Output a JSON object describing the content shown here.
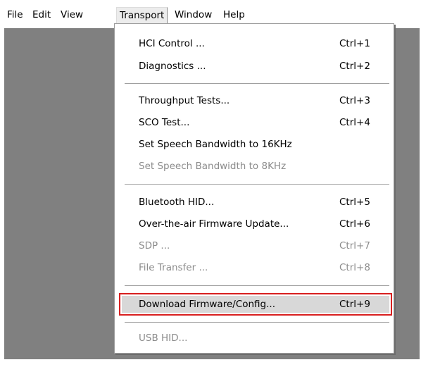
{
  "menubar": {
    "items": [
      {
        "label": "File"
      },
      {
        "label": "Edit"
      },
      {
        "label": "View"
      },
      {
        "label": "Transport"
      },
      {
        "label": "Window"
      },
      {
        "label": "Help"
      }
    ],
    "active": "Transport"
  },
  "transport_menu": {
    "items": [
      {
        "label": "HCI Control ...",
        "shortcut": "Ctrl+1",
        "enabled": true
      },
      {
        "label": "Diagnostics ...",
        "shortcut": "Ctrl+2",
        "enabled": true
      },
      {
        "label": "Throughput Tests...",
        "shortcut": "Ctrl+3",
        "enabled": true
      },
      {
        "label": "SCO Test...",
        "shortcut": "Ctrl+4",
        "enabled": true
      },
      {
        "label": "Set Speech Bandwidth to 16KHz",
        "shortcut": "",
        "enabled": true
      },
      {
        "label": "Set Speech Bandwidth to 8KHz",
        "shortcut": "",
        "enabled": false
      },
      {
        "label": "Bluetooth HID...",
        "shortcut": "Ctrl+5",
        "enabled": true
      },
      {
        "label": "Over-the-air Firmware Update...",
        "shortcut": "Ctrl+6",
        "enabled": true
      },
      {
        "label": "SDP ...",
        "shortcut": "Ctrl+7",
        "enabled": false
      },
      {
        "label": "File Transfer ...",
        "shortcut": "Ctrl+8",
        "enabled": false
      },
      {
        "label": "Download Firmware/Config...",
        "shortcut": "Ctrl+9",
        "enabled": true,
        "highlighted": true
      },
      {
        "label": "USB HID...",
        "shortcut": "",
        "enabled": false
      }
    ]
  },
  "colors": {
    "workspace": "#808080",
    "highlight_outline": "#d81f1f",
    "disabled_text": "#8c8c8c"
  }
}
